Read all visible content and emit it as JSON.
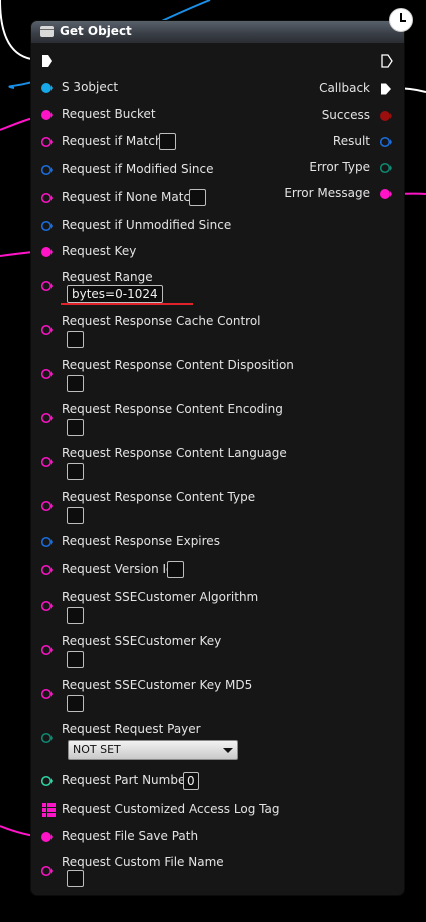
{
  "node": {
    "title": "Get Object",
    "header_icon": "struct-icon",
    "latent_icon": "clock-icon"
  },
  "outputs": [
    {
      "label": "Callback",
      "type": "exec",
      "color": "#ffffff"
    },
    {
      "label": "Success",
      "type": "bool",
      "color": "#9b0f0f"
    },
    {
      "label": "Result",
      "type": "struct",
      "color": "#1a6fe0"
    },
    {
      "label": "Error Type",
      "type": "enum",
      "color": "#0f8a73"
    },
    {
      "label": "Error Message",
      "type": "string",
      "color": "#ff14c8"
    }
  ],
  "inputs": [
    {
      "label": "S 3object",
      "type": "object",
      "color": "#16a8e8",
      "connected": true
    },
    {
      "label": "Request Bucket",
      "type": "string",
      "color": "#ff14c8",
      "connected": true
    },
    {
      "label": "Request if Match",
      "type": "string",
      "color": "#ff14c8",
      "connected": false
    },
    {
      "label": "Request if Modified Since",
      "type": "struct",
      "color": "#1a6fe0",
      "connected": false
    },
    {
      "label": "Request if None Match",
      "type": "string",
      "color": "#ff14c8",
      "connected": false
    },
    {
      "label": "Request if Unmodified Since",
      "type": "struct",
      "color": "#1a6fe0",
      "connected": false
    },
    {
      "label": "Request Key",
      "type": "string",
      "color": "#ff14c8",
      "connected": true
    },
    {
      "label": "Request Range",
      "type": "string",
      "color": "#ff14c8",
      "connected": false,
      "value": "bytes=0-1024"
    },
    {
      "label": "Request Response Cache Control",
      "type": "string",
      "color": "#ff14c8",
      "connected": false
    },
    {
      "label": "Request Response Content Disposition",
      "type": "string",
      "color": "#ff14c8",
      "connected": false
    },
    {
      "label": "Request Response Content Encoding",
      "type": "string",
      "color": "#ff14c8",
      "connected": false
    },
    {
      "label": "Request Response Content Language",
      "type": "string",
      "color": "#ff14c8",
      "connected": false
    },
    {
      "label": "Request Response Content Type",
      "type": "string",
      "color": "#ff14c8",
      "connected": false
    },
    {
      "label": "Request Response Expires",
      "type": "struct",
      "color": "#1a6fe0",
      "connected": false
    },
    {
      "label": "Request Version Id",
      "type": "string",
      "color": "#ff14c8",
      "connected": false
    },
    {
      "label": "Request SSECustomer Algorithm",
      "type": "string",
      "color": "#ff14c8",
      "connected": false
    },
    {
      "label": "Request SSECustomer Key",
      "type": "string",
      "color": "#ff14c8",
      "connected": false
    },
    {
      "label": "Request SSECustomer Key MD5",
      "type": "string",
      "color": "#ff14c8",
      "connected": false
    },
    {
      "label": "Request Request Payer",
      "type": "enum",
      "color": "#0f8a73",
      "connected": false,
      "value": "NOT SET"
    },
    {
      "label": "Request Part Number",
      "type": "int",
      "color": "#2fd6a6",
      "connected": false,
      "value": "0"
    },
    {
      "label": "Request Customized Access Log Tag",
      "type": "map",
      "color": "#ff14c8",
      "connected": false
    },
    {
      "label": "Request File Save Path",
      "type": "string",
      "color": "#ff14c8",
      "connected": true
    },
    {
      "label": "Request Custom File Name",
      "type": "string",
      "color": "#ff14c8",
      "connected": false
    }
  ],
  "colors": {
    "node_body": "#161616",
    "header_top": "#58606a",
    "highlight_underline": "#e0222b",
    "wire_blue": "#1a8fe8",
    "wire_magenta": "#ff14c8",
    "wire_white": "#ffffff"
  }
}
